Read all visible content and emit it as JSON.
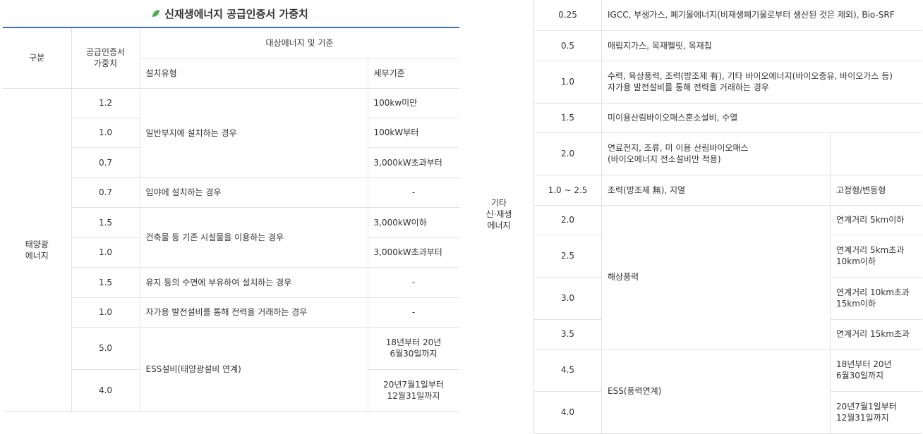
{
  "title": "신재생에너지 공급인증서 가중치",
  "left_table": {
    "headers": {
      "category": "구분",
      "weight": "공급인증서\n가중치",
      "target": "대상에너지 및 기준",
      "install_type": "설치유형",
      "detail": "세부기준"
    },
    "category_label": "태양광\n에너지",
    "weights": [
      "1.2",
      "1.0",
      "0.7",
      "0.7",
      "1.5",
      "1.0",
      "1.5",
      "1.0",
      "5.0",
      "4.0"
    ],
    "install_types": [
      "일반부지에 설치하는 경우",
      "임야에 설치하는 경우",
      "건축물 등 기존 시설물을 이용하는 경우",
      "유지 등의 수면에 부유하여 설치하는 경우",
      "자가용 발전설비를 통해 전력을 거래하는 경우",
      "ESS설비(태양광설비 연계)"
    ],
    "details": [
      "100kw미만",
      "100kW부터",
      "3,000kW초과부터",
      "-",
      "3,000kW이하",
      "3,000kW초과부터",
      "-",
      "-",
      "18년부터 20년\n6월30일까지",
      "20년7월1일부터\n12월31일까지"
    ]
  },
  "right_table": {
    "category_label": "기타\n신·재생\n에너지",
    "weights": [
      "0.25",
      "0.5",
      "1.0",
      "1.5",
      "2.0",
      "1.0 ~ 2.5",
      "2.0",
      "2.5",
      "3.0",
      "3.5",
      "4.5",
      "4.0"
    ],
    "targets": [
      "IGCC, 부생가스, 폐기물에너지(비재생폐기물로부터 생산된 것은 제외), Bio-SRF",
      "매립지가스, 목재펠릿, 목재칩",
      "수력, 육상풍력, 조력(방조제 有), 기타 바이오에너지(바이오중유, 바이오가스 등)\n자가용 발전설비를 통해 전력을 거래하는 경우",
      "미이용산림바이오매스혼소설비, 수열",
      "연료전지, 조류, 미 이용 산림바이오매스\n(바이오에너지 전소설비만 적용)",
      "조력(방조제 無), 지열",
      "해상풍력",
      "ESS(풍력연계)"
    ],
    "details": [
      "고정형/변동형",
      "연계거리 5km이하",
      "연계거리 5km초과\n10km이하",
      "연계거리 10km초과\n15km이하",
      "연계거리 15km초과",
      "18년부터 20년\n6월30일까지",
      "20년7월1일부터\n12월31일까지"
    ]
  },
  "colors": {
    "accent": "#3e6dba",
    "leaf": "#4caf50",
    "border": "#e2e2e2"
  }
}
